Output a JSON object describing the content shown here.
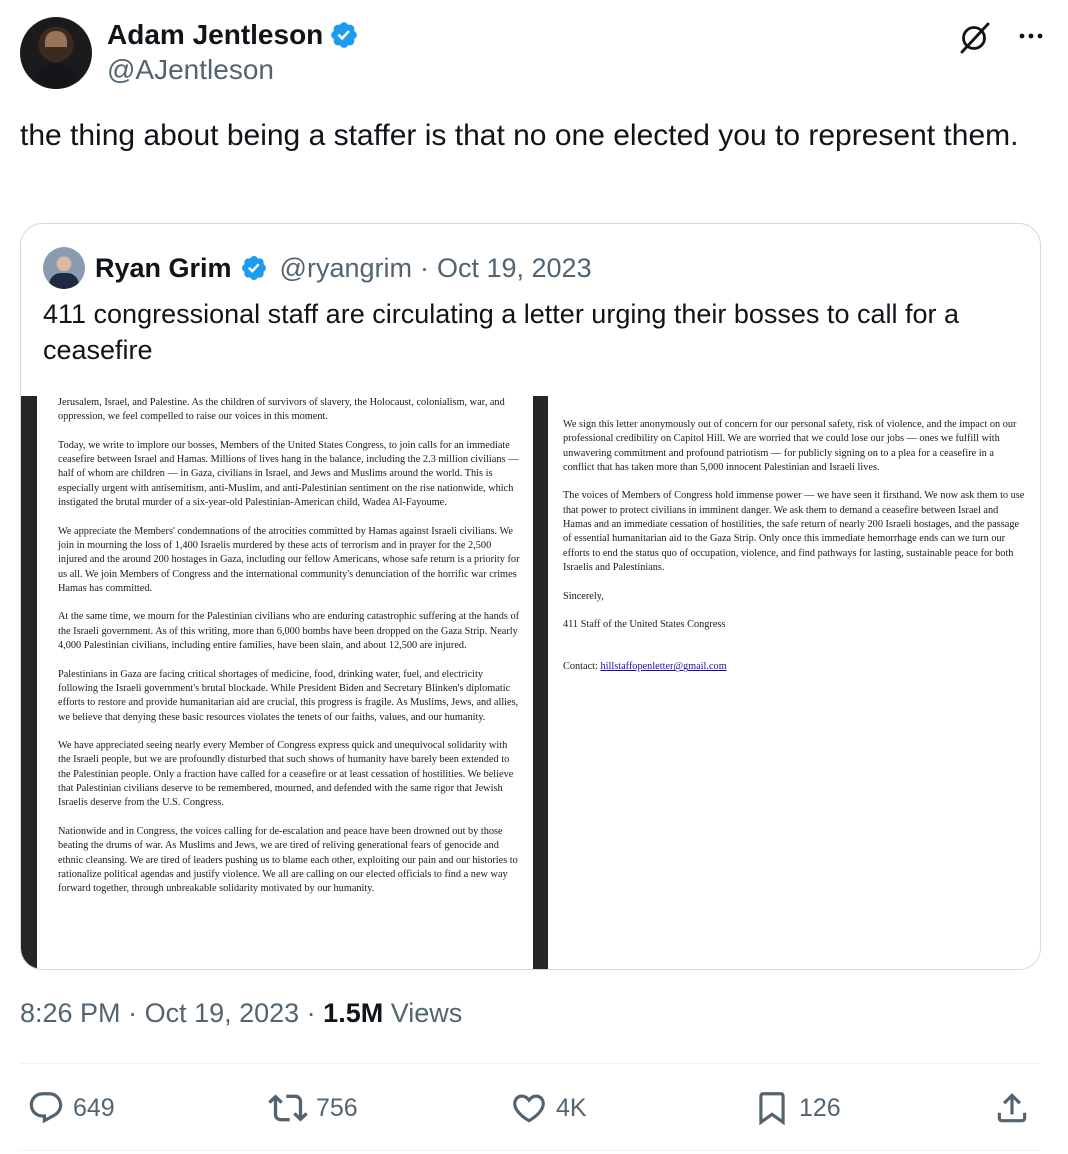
{
  "author": {
    "name": "Adam Jentleson",
    "handle": "@AJentleson",
    "verified_icon": "verified-badge-icon"
  },
  "tweet": {
    "text": "the thing about being a staffer is that no one elected you to represent them."
  },
  "quoted": {
    "name": "Ryan Grim",
    "handle": "@ryangrim",
    "separator": "·",
    "date": "Oct 19, 2023",
    "text": "411 congressional staff are circulating a letter urging their bosses to call for a ceasefire",
    "letter": {
      "page1": [
        "Jerusalem, Israel, and Palestine. As the children of survivors of slavery, the Holocaust, colonialism, war, and oppression, we feel compelled to raise our voices in this moment.",
        "Today, we write to implore our bosses, Members of the United States Congress, to join calls for an immediate ceasefire between Israel and Hamas. Millions of lives hang in the balance, including the 2.3 million civilians — half of whom are children — in Gaza, civilians in Israel, and Jews and Muslims around the world. This is especially urgent with antisemitism, anti-Muslim, and anti-Palestinian sentiment on the rise nationwide, which instigated the brutal murder of a six-year-old Palestinian-American child, Wadea Al-Fayoume.",
        "We appreciate the Members' condemnations of the atrocities committed by Hamas against Israeli civilians. We join in mourning the loss of 1,400 Israelis murdered by these acts of terrorism and in prayer for the 2,500 injured and the around 200 hostages in Gaza, including our fellow Americans, whose safe return is a priority for us all. We join Members of Congress and the international community's denunciation of the horrific war crimes Hamas has committed.",
        "At the same time, we mourn for the Palestinian civilians who are enduring catastrophic suffering at the hands of the Israeli government. As of this writing, more than 6,000 bombs have been dropped on the Gaza Strip. Nearly 4,000 Palestinian civilians, including entire families, have been slain, and about 12,500 are injured.",
        "Palestinians in Gaza are facing critical shortages of medicine, food, drinking water, fuel, and electricity following the Israeli government's brutal blockade. While President Biden and Secretary Blinken's diplomatic efforts to restore and provide humanitarian aid are crucial, this progress is fragile. As Muslims, Jews, and allies, we believe that denying these basic resources violates the tenets of our faiths, values, and our humanity.",
        "We have appreciated seeing nearly every Member of Congress express quick and unequivocal solidarity with the Israeli people, but we are profoundly disturbed that such shows of humanity have barely been extended to the Palestinian people. Only a fraction have called for a ceasefire or at least cessation of hostilities. We believe that Palestinian civilians deserve to be remembered, mourned, and defended with the same rigor that Jewish Israelis deserve from the U.S. Congress.",
        "Nationwide and in Congress, the voices calling for de-escalation and peace have been drowned out by those beating the drums of war. As Muslims and Jews, we are tired of reliving generational fears of genocide and ethnic cleansing. We are tired of leaders pushing us to blame each other, exploiting our pain and our histories to rationalize political agendas and justify violence. We all are calling on our elected officials to find a new way forward together, through unbreakable solidarity motivated by our humanity."
      ],
      "page2": [
        "We sign this letter anonymously out of concern for our personal safety, risk of violence, and the impact on our professional credibility on Capitol Hill. We are worried that we could lose our jobs — ones we fulfill with unwavering commitment and profound patriotism — for publicly signing on to a plea for a ceasefire in a conflict that has taken more than 5,000 innocent Palestinian and Israeli lives.",
        "The voices of Members of Congress hold immense power — we have seen it firsthand. We now ask them to use that power to protect civilians in imminent danger. We ask them to demand a ceasefire between Israel and Hamas and an immediate cessation of hostilities, the safe return of nearly 200 Israeli hostages, and the passage of essential humanitarian aid to the Gaza Strip. Only once this immediate hemorrhage ends can we turn our efforts to end the status quo of occupation, violence, and find pathways for lasting, sustainable peace for both Israelis and Palestinians.",
        "Sincerely,",
        "411 Staff of the United States Congress"
      ],
      "contact_label": "Contact:",
      "contact_email": "hillstaffopenletter@gmail.com"
    }
  },
  "meta": {
    "time": "8:26 PM",
    "sep1": " · ",
    "date": "Oct 19, 2023",
    "sep2": " · ",
    "views_count": "1.5M",
    "views_label": " Views"
  },
  "actions": {
    "replies": "649",
    "reposts": "756",
    "likes": "4K",
    "bookmarks": "126"
  },
  "colors": {
    "verified": "#1d9bf0",
    "secondary_text": "#536471",
    "primary_text": "#0f1419",
    "border": "#cfd9de"
  }
}
